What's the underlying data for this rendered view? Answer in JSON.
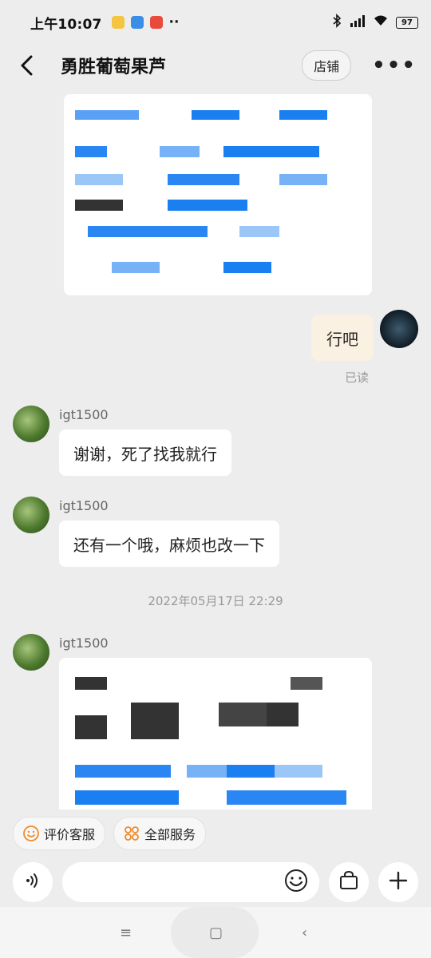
{
  "status_bar": {
    "time": "上午10:07",
    "battery": "97",
    "more": "··"
  },
  "header": {
    "title": "勇胜葡萄果芦",
    "store_label": "店铺",
    "back_icon": "back-arrow-icon",
    "menu_icon": "more-dots-icon"
  },
  "chat": {
    "my_message": "行吧",
    "read_status": "已读",
    "messages": [
      {
        "user": "igt1500",
        "text": "谢谢，死了找我就行"
      },
      {
        "user": "igt1500",
        "text": "还有一个哦，麻烦也改一下"
      }
    ],
    "timestamp": "2022年05月17日 22:29",
    "third_user": "igt1500"
  },
  "quick_actions": [
    {
      "label": "评价客服",
      "icon": "smile-icon",
      "color": "#f08a2c"
    },
    {
      "label": "全部服务",
      "icon": "grid-icon",
      "color": "#f08a2c"
    }
  ],
  "input": {
    "voice_icon": "voice-icon",
    "emoji_icon": "emoji-icon",
    "bag_icon": "bag-icon",
    "plus_icon": "plus-icon"
  },
  "nav": {
    "menu_icon": "menu-icon",
    "home_icon": "home-icon",
    "back_icon": "back-icon",
    "menu_glyph": "≡",
    "home_glyph": "▢",
    "back_glyph": "‹"
  }
}
